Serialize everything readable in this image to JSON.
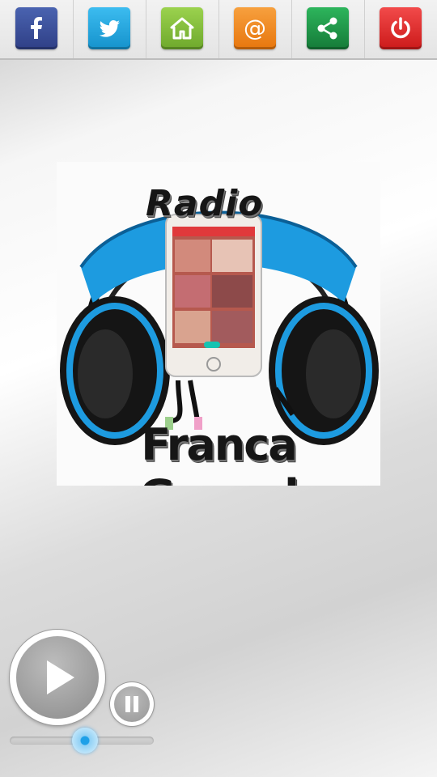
{
  "toolbar": {
    "buttons": [
      {
        "name": "facebook-button",
        "icon": "facebook-icon",
        "color": "#3b4f9a"
      },
      {
        "name": "twitter-button",
        "icon": "twitter-bird-icon",
        "color": "#1da8e0"
      },
      {
        "name": "home-button",
        "icon": "home-icon",
        "color": "#86c03c"
      },
      {
        "name": "email-button",
        "icon": "at-sign-icon",
        "color": "#f28a1e"
      },
      {
        "name": "share-button",
        "icon": "share-icon",
        "color": "#1f9a4a"
      },
      {
        "name": "power-button",
        "icon": "power-icon",
        "color": "#e52a2a"
      }
    ]
  },
  "logo": {
    "line1": "Radio",
    "line2": "Franca Gospel"
  },
  "player": {
    "play_icon": "play-icon",
    "pause_icon": "pause-icon",
    "volume_fraction": 0.52,
    "accent": "#1ea0e8"
  }
}
